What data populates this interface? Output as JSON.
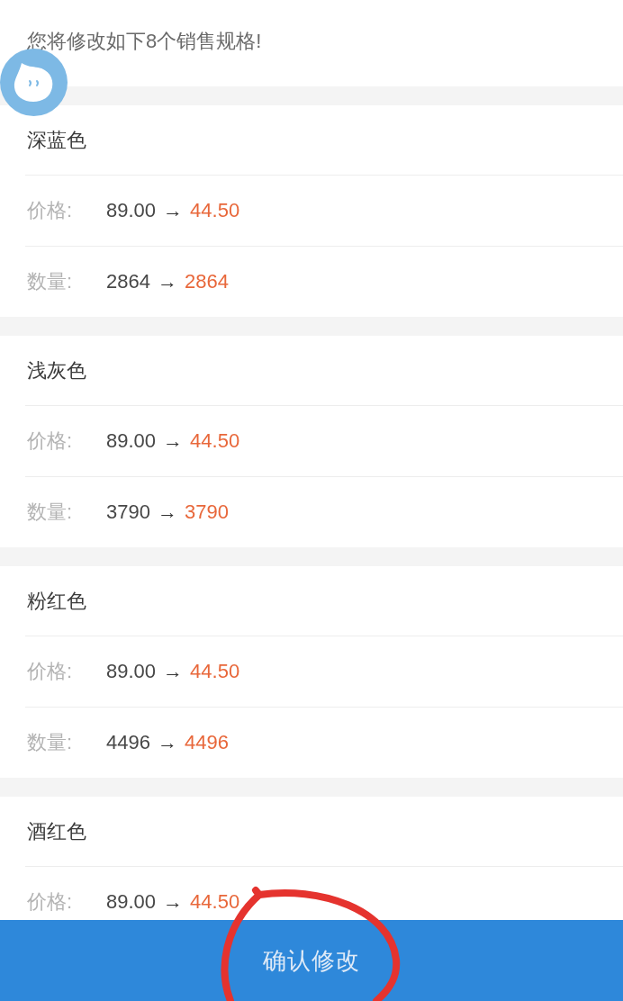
{
  "header": {
    "message": "您将修改如下8个销售规格!"
  },
  "specs": [
    {
      "name": "深蓝色",
      "rows": [
        {
          "label": "价格:",
          "old": "89.00",
          "arrow": "→",
          "new": "44.50"
        },
        {
          "label": "数量:",
          "old": "2864",
          "arrow": "→",
          "new": "2864"
        }
      ]
    },
    {
      "name": "浅灰色",
      "rows": [
        {
          "label": "价格:",
          "old": "89.00",
          "arrow": "→",
          "new": "44.50"
        },
        {
          "label": "数量:",
          "old": "3790",
          "arrow": "→",
          "new": "3790"
        }
      ]
    },
    {
      "name": "粉红色",
      "rows": [
        {
          "label": "价格:",
          "old": "89.00",
          "arrow": "→",
          "new": "44.50"
        },
        {
          "label": "数量:",
          "old": "4496",
          "arrow": "→",
          "new": "4496"
        }
      ]
    },
    {
      "name": "酒红色",
      "rows": [
        {
          "label": "价格:",
          "old": "89.00",
          "arrow": "→",
          "new": "44.50"
        }
      ]
    }
  ],
  "confirm_button": {
    "label": "确认修改"
  }
}
